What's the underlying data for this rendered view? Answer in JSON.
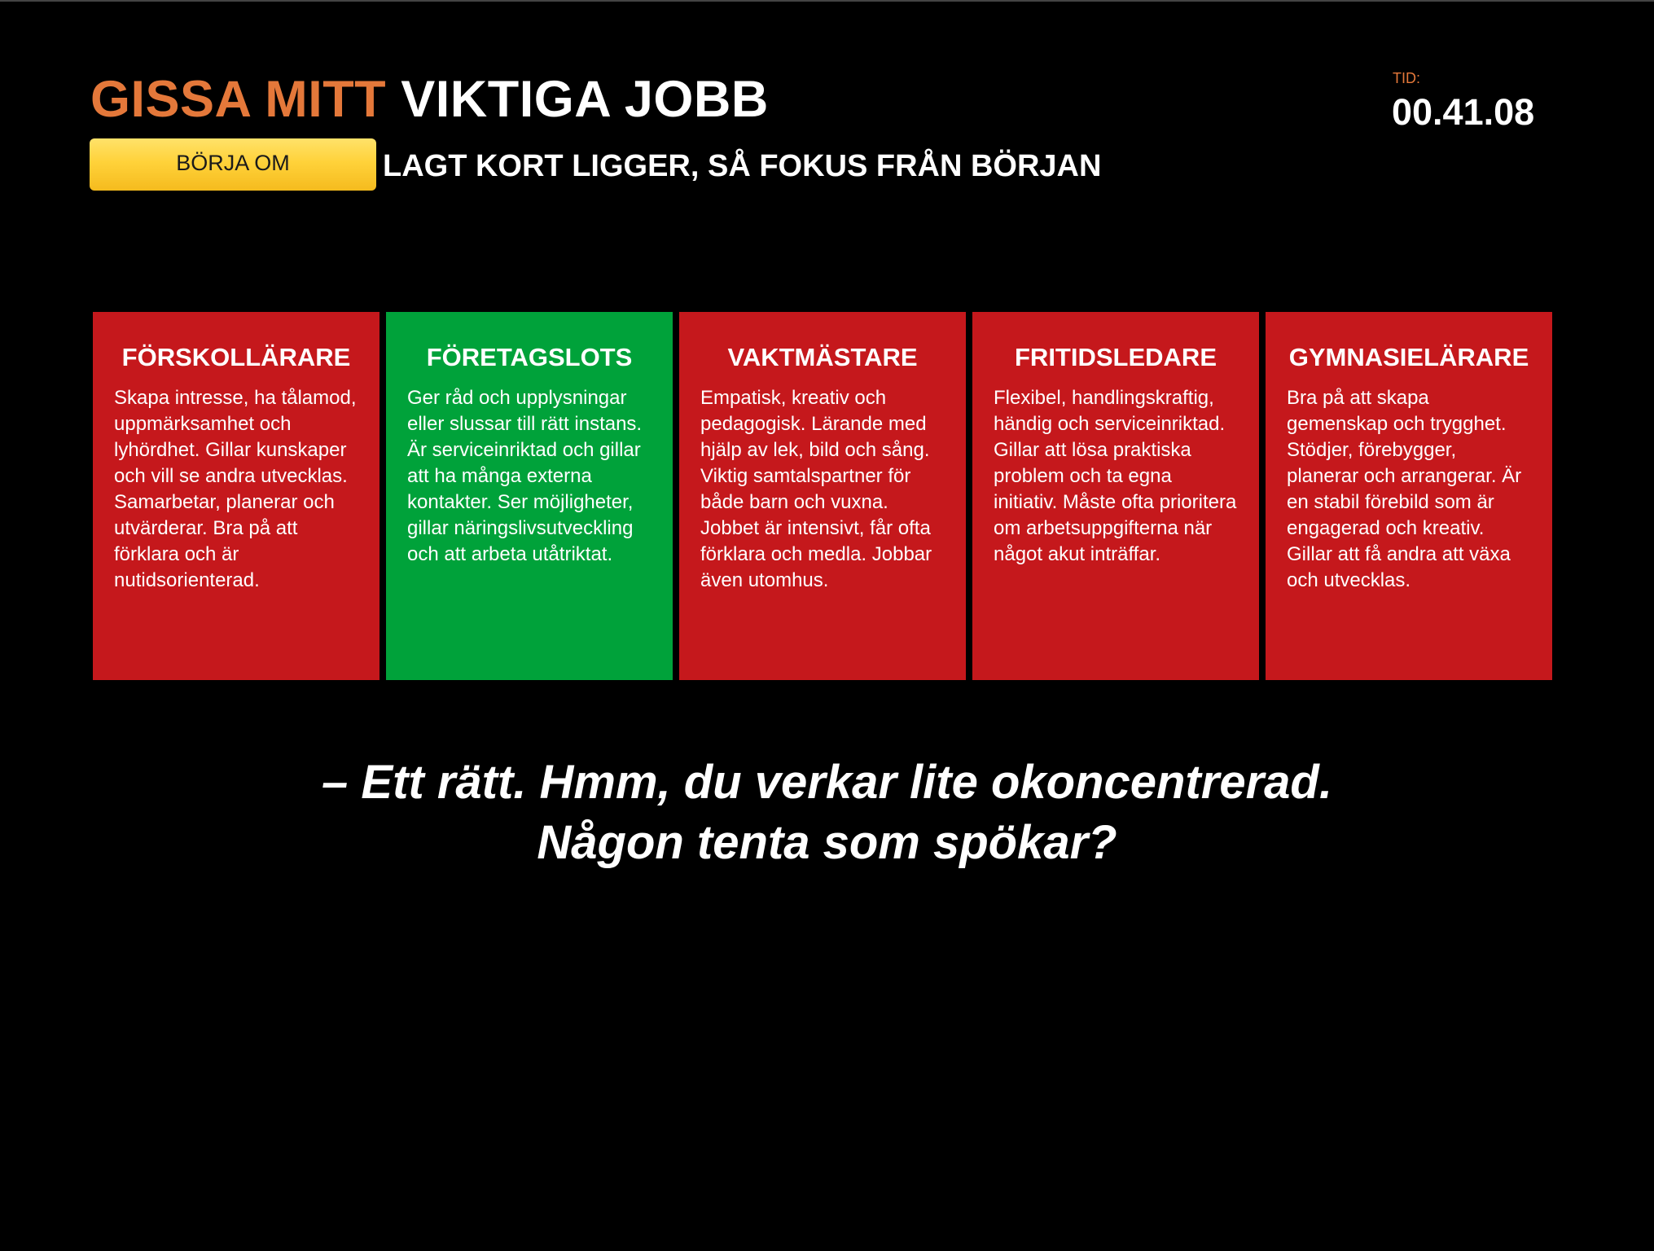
{
  "header": {
    "title_part1": "GISSA MITT",
    "title_part2": "VIKTIGA JOBB",
    "subtitle": "LAGT KORT LIGGER, SÅ FOKUS FRÅN BÖRJAN",
    "restart_label": "BÖRJA OM"
  },
  "timer": {
    "label": "TID:",
    "value": "00.41.08"
  },
  "colors": {
    "accent_orange": "#e4783a",
    "wrong_red": "#c5181c",
    "correct_green": "#00a23a",
    "button_yellow": "#ffd23a"
  },
  "cards": [
    {
      "title": "FÖRSKOLLÄRARE",
      "description": "Skapa intresse, ha tålamod, uppmärksamhet och lyhördhet. Gillar kunskaper och vill se andra utvecklas. Samarbetar, planerar och utvärderar. Bra på att förklara och är nutidsorienterad.",
      "status": "wrong",
      "color": "#c5181c"
    },
    {
      "title": "FÖRETAGSLOTS",
      "description": "Ger råd och upplysningar eller slussar till rätt instans. Är serviceinriktad och gillar att ha många externa kontakter. Ser möjligheter, gillar näringslivsutveckling och att arbeta utåtriktat.",
      "status": "correct",
      "color": "#00a23a"
    },
    {
      "title": "VAKTMÄSTARE",
      "description": "Empatisk, kreativ och pedagogisk. Lärande med hjälp av lek, bild och sång. Viktig samtalspartner för både barn och vuxna. Jobbet är intensivt, får ofta förklara och medla. Jobbar även utomhus.",
      "status": "wrong",
      "color": "#c5181c"
    },
    {
      "title": "FRITIDSLEDARE",
      "description": "Flexibel, handlingskraftig, händig och serviceinriktad. Gillar att lösa praktiska problem och ta egna initiativ. Måste ofta prioritera om arbetsuppgifterna när något akut inträffar.",
      "status": "wrong",
      "color": "#c5181c"
    },
    {
      "title": "GYMNASIELÄRARE",
      "description": "Bra på att skapa gemenskap och trygghet. Stödjer, förebygger, planerar och arrangerar. Är en stabil förebild som är engagerad och kreativ. Gillar att få andra att växa och utvecklas.",
      "status": "wrong",
      "color": "#c5181c"
    }
  ],
  "message": {
    "line1": "– Ett rätt. Hmm, du verkar lite okoncentrerad.",
    "line2": "Någon tenta som spökar?"
  }
}
